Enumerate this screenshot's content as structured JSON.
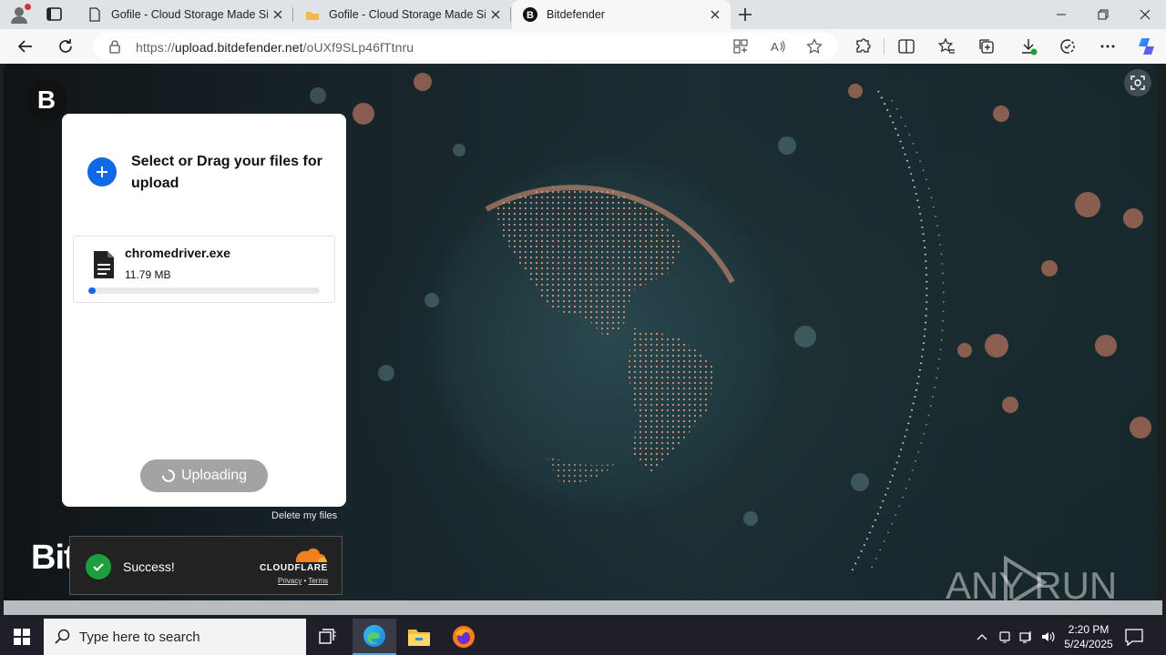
{
  "browser": {
    "tabs": [
      {
        "title": "Gofile - Cloud Storage Made Sim",
        "favicon": "document-icon",
        "active": false
      },
      {
        "title": "Gofile - Cloud Storage Made Sim",
        "favicon": "gofile-icon",
        "active": false
      },
      {
        "title": "Bitdefender",
        "favicon": "bitdefender-b-icon",
        "active": true
      }
    ],
    "url_scheme": "https://",
    "url_host": "upload.bitdefender.net",
    "url_path": "/oUXf9SLp46fTtnru"
  },
  "page": {
    "logo_letter": "B",
    "brand_text": "Bit",
    "upload_card": {
      "select_prompt": "Select or Drag your files for upload",
      "file": {
        "name": "chromedriver.exe",
        "size": "11.79 MB",
        "progress_percent": 3
      },
      "upload_button": "Uploading"
    },
    "delete_link": "Delete my files",
    "captcha": {
      "status": "Success!",
      "brand": "CLOUDFLARE",
      "privacy": "Privacy",
      "separator": "•",
      "terms": "Terms"
    },
    "watermark": "ANY RUN"
  },
  "taskbar": {
    "search_placeholder": "Type here to search",
    "time": "2:20 PM",
    "date": "5/24/2025"
  },
  "colors": {
    "accent": "#1068e6",
    "success": "#1c9f3c",
    "cloudflare_orange": "#f38020"
  }
}
